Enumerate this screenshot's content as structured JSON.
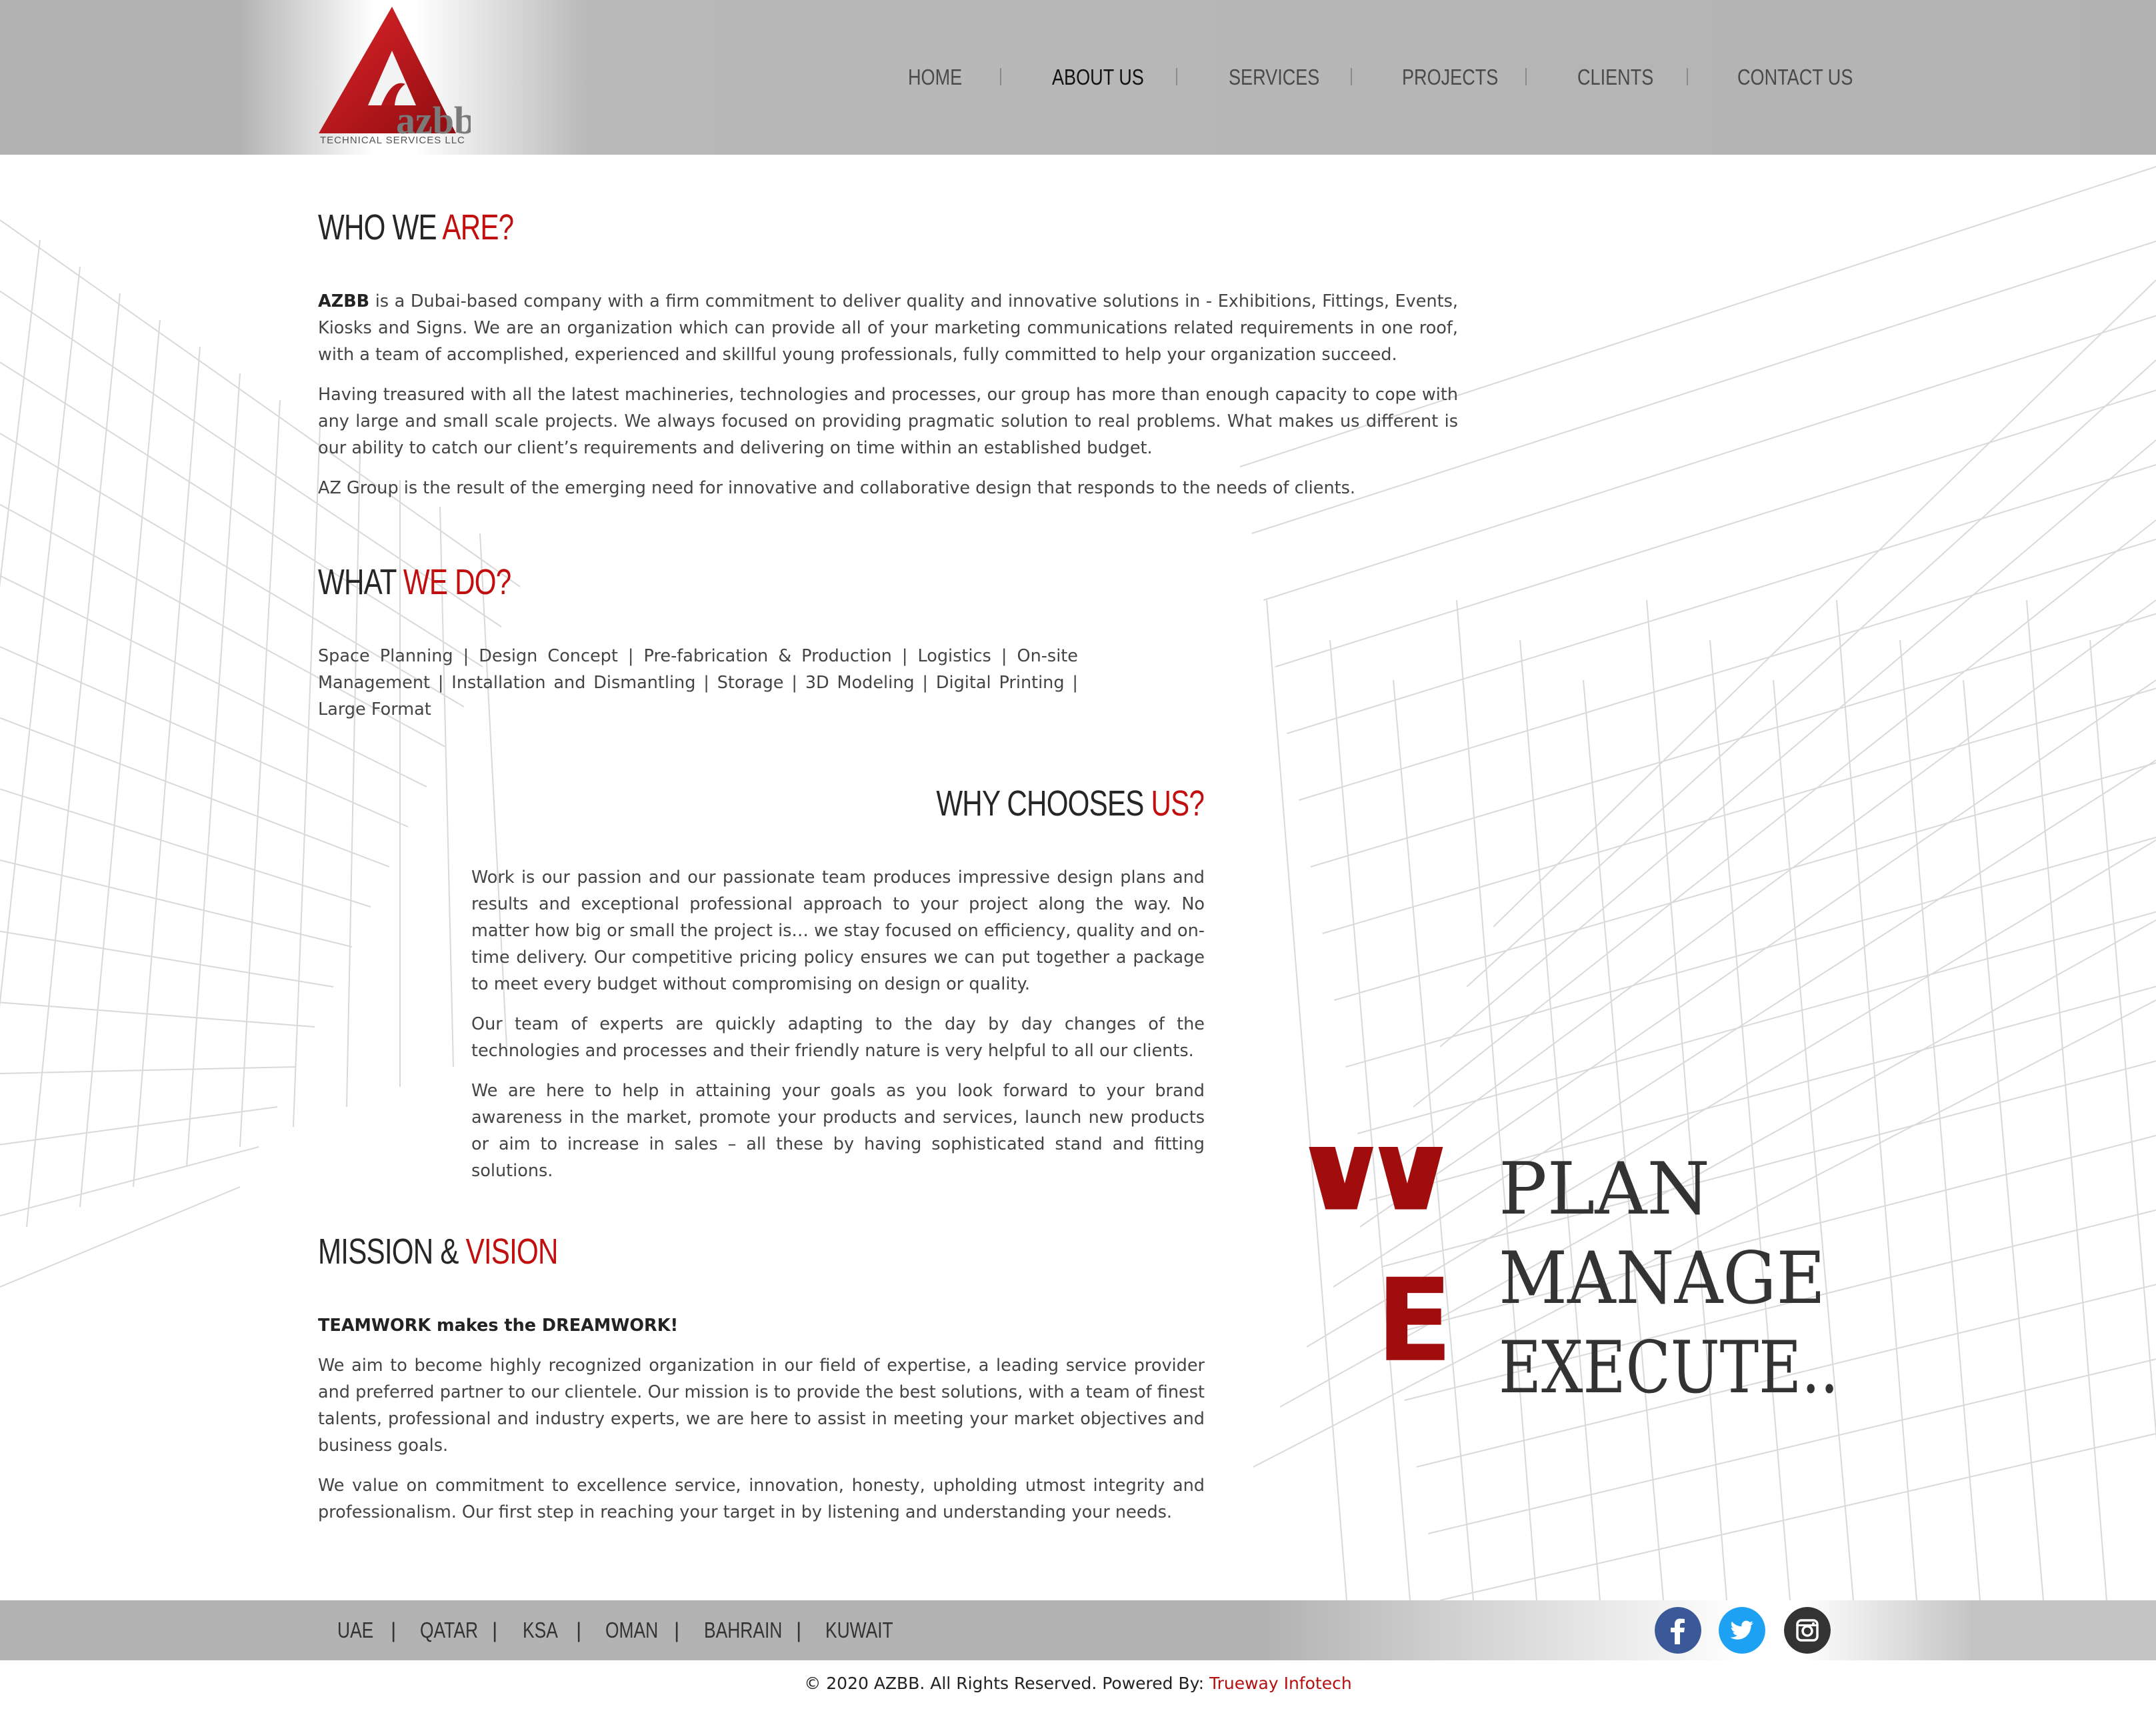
{
  "brand": {
    "logo_text": "azbb",
    "logo_subtitle": "TECHNICAL SERVICES LLC",
    "accent_color": "#c10f0f"
  },
  "nav": {
    "items": [
      {
        "label": "HOME",
        "active": false
      },
      {
        "label": "ABOUT US",
        "active": true
      },
      {
        "label": "SERVICES",
        "active": false
      },
      {
        "label": "PROJECTS",
        "active": false
      },
      {
        "label": "CLIENTS",
        "active": false
      },
      {
        "label": "CONTACT US",
        "active": false
      }
    ]
  },
  "who": {
    "title_plain": "WHO WE",
    "title_red": "ARE?",
    "p1_bold": "AZBB",
    "p1_rest": " is a Dubai-based company with a firm commitment to deliver quality and innovative solutions in - Exhibitions, Fittings, Events, Kiosks and Signs. We are an organization which can provide all of your marketing communications related requirements in one roof, with a team of accomplished, experienced and skillful young professionals, fully committed to help your organization succeed.",
    "p2": "Having treasured with all the latest machineries, technologies and processes, our group has more than enough capacity to cope with any large and small scale projects. We always focused on providing pragmatic solution to real problems. What makes us different is our ability to catch our client’s requirements and delivering on time within an established budget.",
    "p3": "AZ Group is the result of the emerging need for innovative and collaborative design that responds to the needs of clients."
  },
  "what": {
    "title_plain": "WHAT",
    "title_red": "WE DO?",
    "text": "Space Planning | Design Concept | Pre-fabrication & Production | Logistics | On-site Management | Installation and Dismantling | Storage | 3D Modeling | Digital Printing | Large Format"
  },
  "why": {
    "title_plain": "WHY CHOOSES",
    "title_red": "US?",
    "p1": "Work is our passion and our passionate team produces impressive design plans and results and exceptional professional approach to your project along the way. No matter how big or small the project is… we stay focused on efficiency, quality and on-time delivery. Our competitive pricing policy ensures we can put together a package to meet every budget without compromising on design or quality.",
    "p2": "Our team of experts are quickly adapting to the day by day changes of the technologies and processes and their friendly nature is very helpful to all our clients.",
    "p3": "We are here to help in attaining your goals as you look forward to your brand awareness in the market, promote your products and services, launch new products or aim to increase in sales – all these by having sophisticated stand and fitting solutions."
  },
  "mission": {
    "title_plain": "MISSION &",
    "title_red": "VISION",
    "tagline": "TEAMWORK makes the DREAMWORK!",
    "p1": "We aim to become highly recognized organization in our field of expertise, a leading service provider and preferred partner to our clientele. Our mission is to provide the best solutions, with a team of finest talents, professional and industry experts, we are here to assist in meeting your market objectives and business goals.",
    "p2": "We value on commitment to excellence service, innovation, honesty, upholding utmost integrity and professionalism. Our first step in reaching your target in by listening and understanding your needs."
  },
  "we_graphic": {
    "letter_w": "W",
    "letter_e": "E",
    "line1": "PLAN",
    "line2": "MANAGE",
    "line3": "EXECUTE.."
  },
  "footer": {
    "countries": [
      "UAE",
      "QATAR",
      "KSA",
      "OMAN",
      "BAHRAIN",
      "KUWAIT"
    ],
    "separator": "|",
    "social": [
      {
        "icon": "facebook-icon",
        "color": "#3b5998"
      },
      {
        "icon": "twitter-icon",
        "color": "#1da1f2"
      },
      {
        "icon": "instagram-icon",
        "color": "#333333"
      }
    ],
    "copyright_text": "© 2020 AZBB. All Rights Reserved. Powered By: ",
    "powered_by": "Trueway Infotech"
  }
}
